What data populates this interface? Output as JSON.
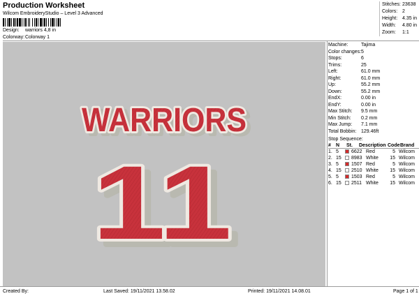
{
  "header": {
    "title": "Production Worksheet",
    "subtitle": "Wilcom EmbroideryStudio – Level 3 Advanced",
    "design_label": "Design:",
    "design_value": "warriors 4,8 in",
    "colorway_label": "Colorway:",
    "colorway_value": "Colorway 1"
  },
  "summary": [
    {
      "label": "Stitches:",
      "value": "23638"
    },
    {
      "label": "Colors:",
      "value": "2"
    },
    {
      "label": "Height:",
      "value": "4.35 in"
    },
    {
      "label": "Width:",
      "value": "4.80 in"
    },
    {
      "label": "Zoom:",
      "value": "1:1"
    }
  ],
  "design": {
    "word": "WARRIORS",
    "number": "11",
    "fill_color": "#c8323c",
    "outline_color": "#efe9e2",
    "shadow_color": "#b9b9b0",
    "background_color": "#c2c2c2"
  },
  "properties": [
    {
      "label": "Machine:",
      "value": "Tajima"
    },
    {
      "label": "Color changes:",
      "value": "5"
    },
    {
      "label": "Stops:",
      "value": "6"
    },
    {
      "label": "Trims:",
      "value": "25"
    },
    {
      "label": "Left:",
      "value": "61.0 mm"
    },
    {
      "label": "Right:",
      "value": "61.0 mm"
    },
    {
      "label": "Up:",
      "value": "55.2 mm"
    },
    {
      "label": "Down:",
      "value": "55.2 mm"
    },
    {
      "label": "EndX:",
      "value": "0.00 in"
    },
    {
      "label": "EndY:",
      "value": "0.00 in"
    },
    {
      "label": "Max Stitch:",
      "value": "9.5 mm"
    },
    {
      "label": "Min Stitch:",
      "value": "0.2 mm"
    },
    {
      "label": "Max Jump:",
      "value": "7.1 mm"
    },
    {
      "label": "Total Bobbin:",
      "value": "129.46ft"
    }
  ],
  "stop_sequence": {
    "title": "Stop Sequence:",
    "headers": [
      "#",
      "N",
      "St.",
      "Description",
      "Code",
      "Brand"
    ],
    "rows": [
      {
        "num": "1.",
        "n": "5",
        "st": "6622",
        "desc": "Red",
        "code": "5",
        "brand": "Wilcom",
        "color": "#d42a2a"
      },
      {
        "num": "2.",
        "n": "15",
        "st": "8983",
        "desc": "White",
        "code": "15",
        "brand": "Wilcom",
        "color": "#ffffff"
      },
      {
        "num": "3.",
        "n": "5",
        "st": "1507",
        "desc": "Red",
        "code": "5",
        "brand": "Wilcom",
        "color": "#d42a2a"
      },
      {
        "num": "4.",
        "n": "15",
        "st": "2510",
        "desc": "White",
        "code": "15",
        "brand": "Wilcom",
        "color": "#ffffff"
      },
      {
        "num": "5.",
        "n": "5",
        "st": "1503",
        "desc": "Red",
        "code": "5",
        "brand": "Wilcom",
        "color": "#d42a2a"
      },
      {
        "num": "6.",
        "n": "15",
        "st": "2511",
        "desc": "White",
        "code": "15",
        "brand": "Wilcom",
        "color": "#ffffff"
      }
    ]
  },
  "footer": {
    "created_by": "Created By:",
    "last_saved": "Last Saved: 19/11/2021 13.58.02",
    "printed": "Printed: 19/11/2021 14.08.01",
    "page": "Page 1 of 1"
  }
}
